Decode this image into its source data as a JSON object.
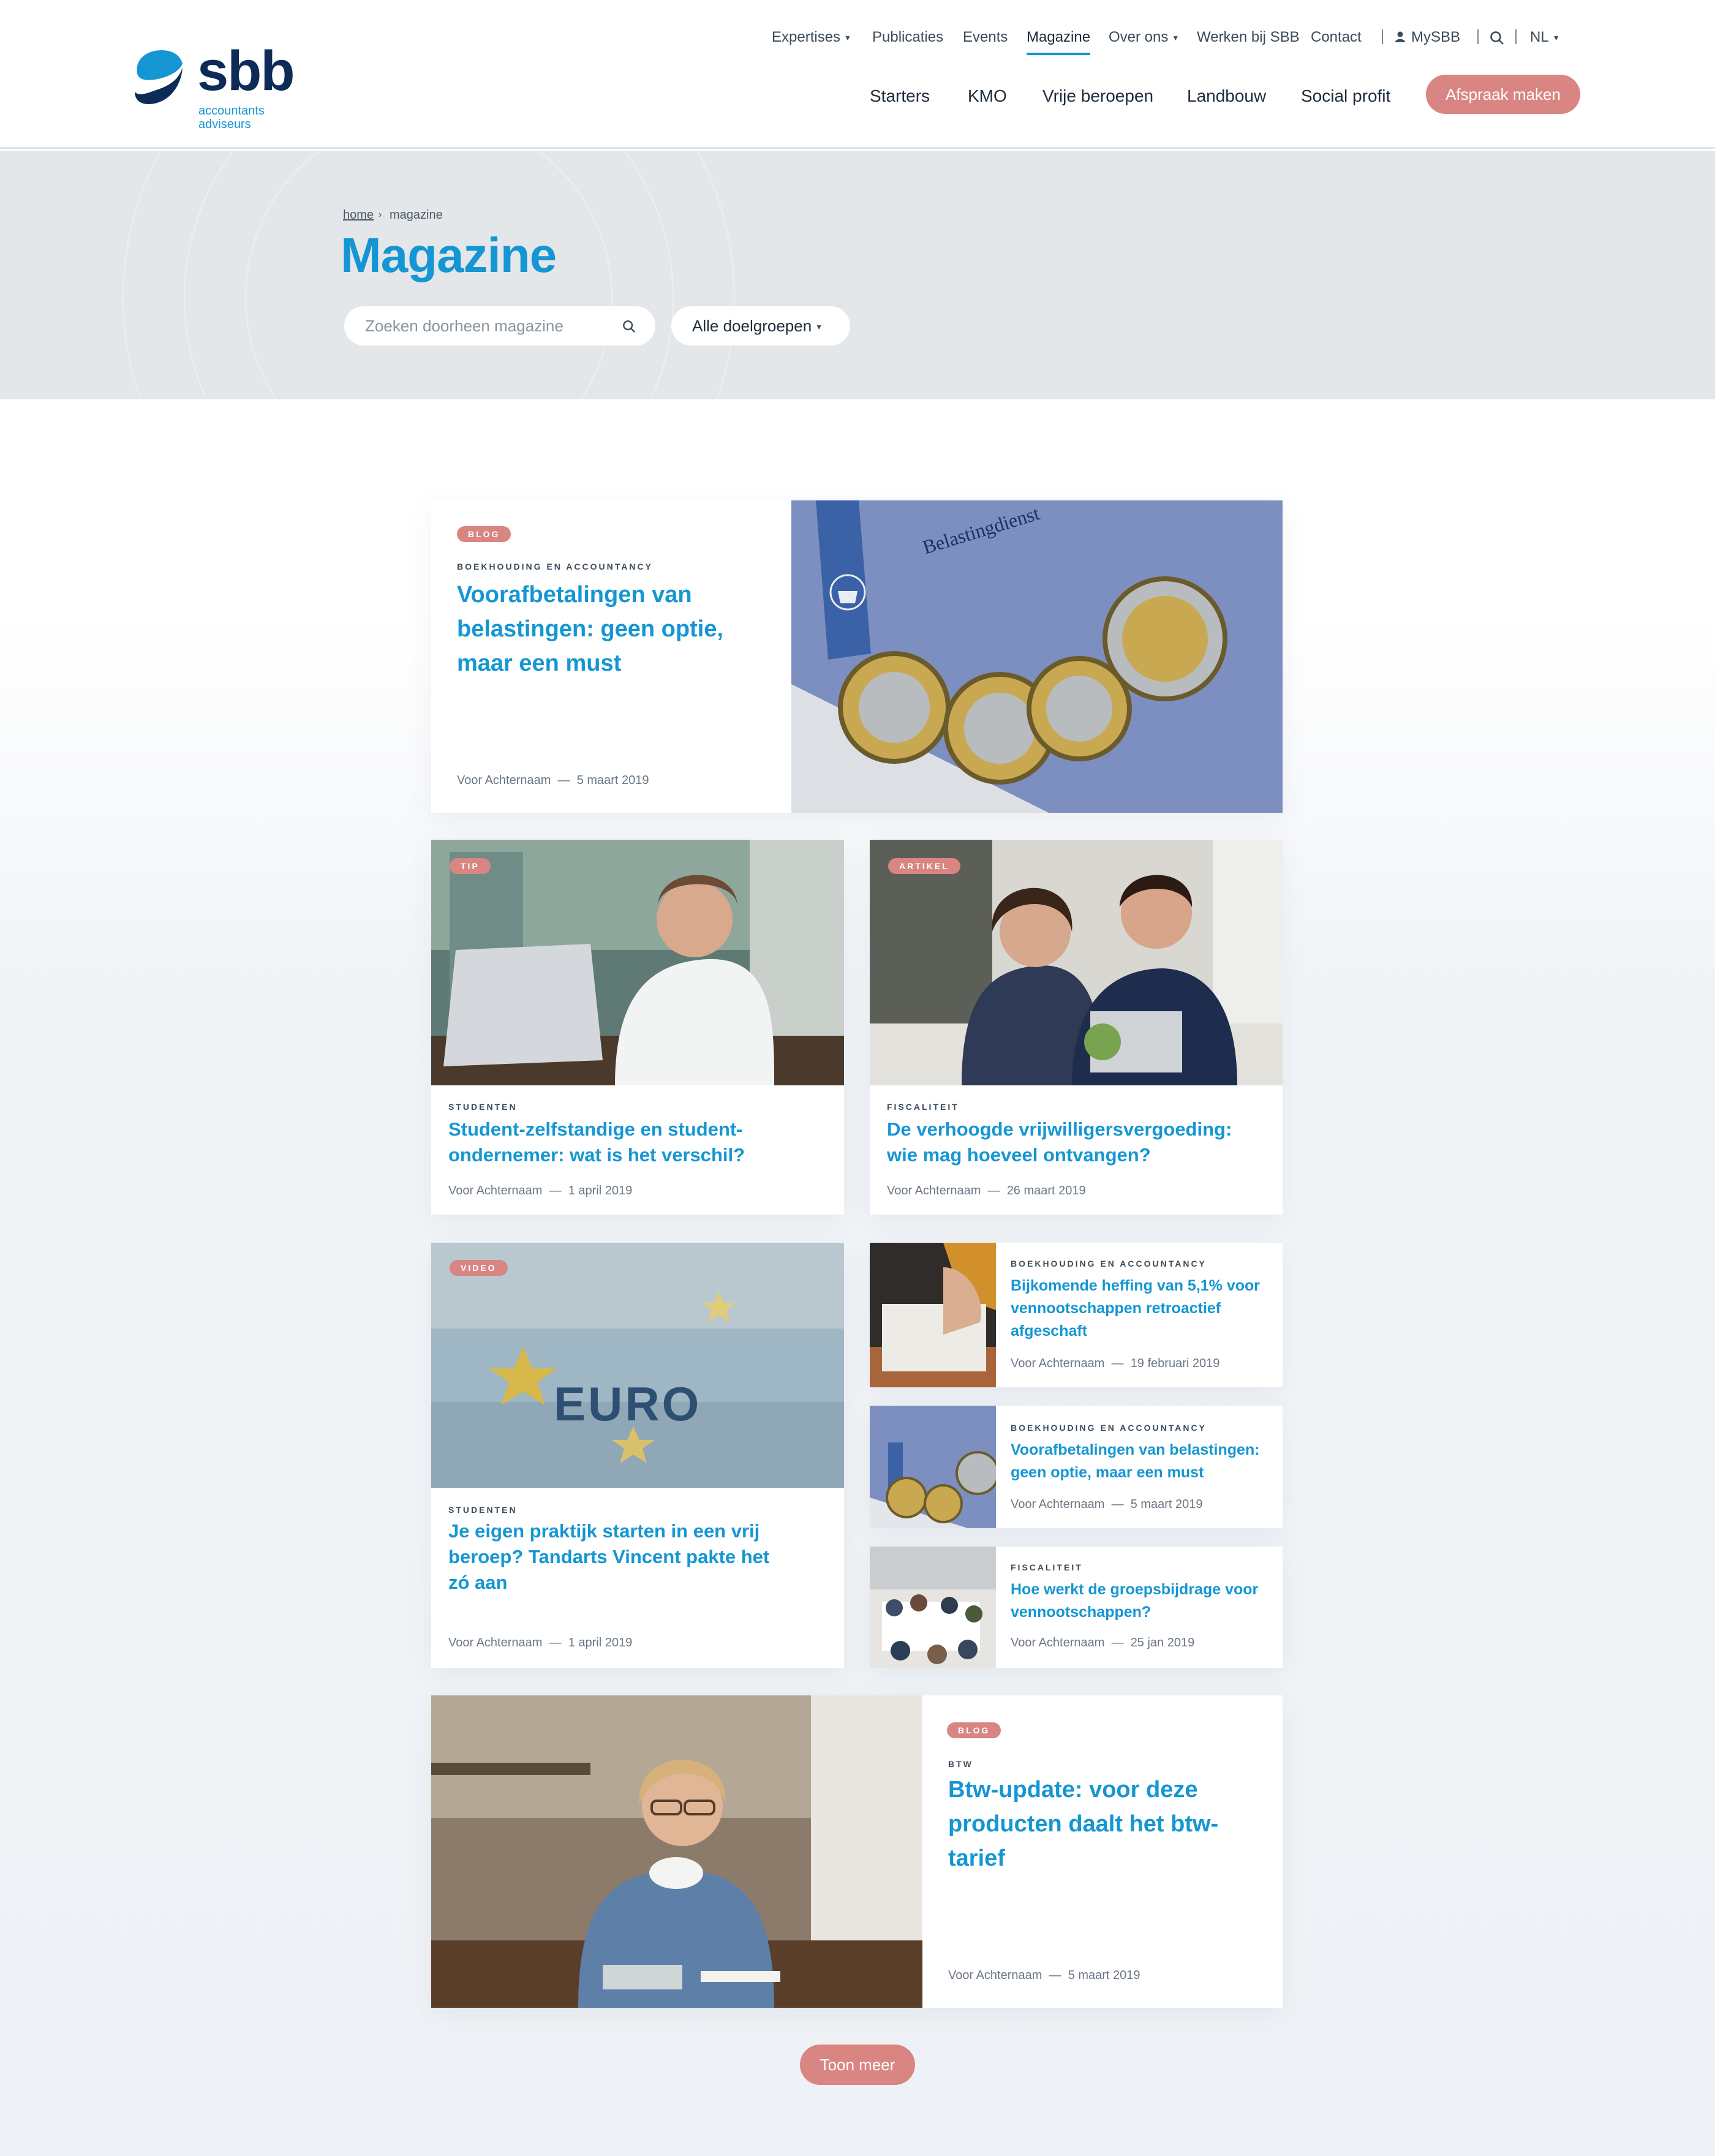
{
  "brand": {
    "name": "sbb",
    "tagline_line1": "accountants",
    "tagline_line2": "adviseurs"
  },
  "top_nav": [
    "Expertises",
    "Publicaties",
    "Events",
    "Magazine",
    "Over ons",
    "Werken bij SBB",
    "Contact",
    "MySBB",
    "NL"
  ],
  "main_nav": [
    "Starters",
    "KMO",
    "Vrije beroepen",
    "Landbouw",
    "Social profit"
  ],
  "cta_label": "Afspraak maken",
  "breadcrumb": {
    "home": "home",
    "separator": "›",
    "current": "magazine"
  },
  "page_title": "Magazine",
  "search": {
    "placeholder": "Zoeken doorheen magazine"
  },
  "filter": {
    "selected": "Alle doelgroepen"
  },
  "featured": {
    "badge": "BLOG",
    "category": "BOEKHOUDING EN ACCOUNTANCY",
    "title": "Voorafbetalingen van belastingen: geen optie, maar een must",
    "author": "Voor Achternaam",
    "date": "5 maart 2019",
    "image_text": "Belastingdienst"
  },
  "cards": [
    {
      "badge": "TIP",
      "category": "STUDENTEN",
      "title": "Student-zelfstandige en student-ondernemer: wat is het verschil?",
      "author": "Voor Achternaam",
      "date": "1 april 2019"
    },
    {
      "badge": "ARTIKEL",
      "category": "FISCALITEIT",
      "title": "De verhoogde vrijwilligersvergoeding: wie mag hoeveel ontvangen?",
      "author": "Voor Achternaam",
      "date": "26 maart 2019"
    },
    {
      "badge": "VIDEO",
      "category": "STUDENTEN",
      "title": "Je eigen praktijk starten in een vrij beroep? Tandarts Vincent pakte het zó aan",
      "author": "Voor Achternaam",
      "date": "1 april 2019",
      "image_text": "EURO"
    }
  ],
  "small_cards": [
    {
      "category": "BOEKHOUDING EN ACCOUNTANCY",
      "title": "Bijkomende heffing van 5,1% voor vennootschappen retroactief afgeschaft",
      "author": "Voor Achternaam",
      "date": "19 februari 2019"
    },
    {
      "category": "BOEKHOUDING EN ACCOUNTANCY",
      "title": "Voorafbetalingen van belastingen: geen optie, maar een must",
      "author": "Voor Achternaam",
      "date": "5 maart 2019"
    },
    {
      "category": "FISCALITEIT",
      "title": "Hoe werkt de groepsbijdrage voor vennootschappen?",
      "author": "Voor Achternaam",
      "date": "25 jan 2019"
    }
  ],
  "bottom_featured": {
    "badge": "BLOG",
    "category": "BTW",
    "title": "Btw-update: voor deze producten daalt het btw-tarief",
    "author": "Voor Achternaam",
    "date": "5 maart 2019"
  },
  "meta_separator": "—",
  "load_more": "Toon meer",
  "colors": {
    "accent": "#1596d3",
    "brand_navy": "#0e2b57",
    "pink": "#d98582",
    "hero_bg": "#e4e7ea"
  },
  "icons": {
    "user": "user-icon",
    "search": "search-icon",
    "caret": "caret-down-icon"
  }
}
